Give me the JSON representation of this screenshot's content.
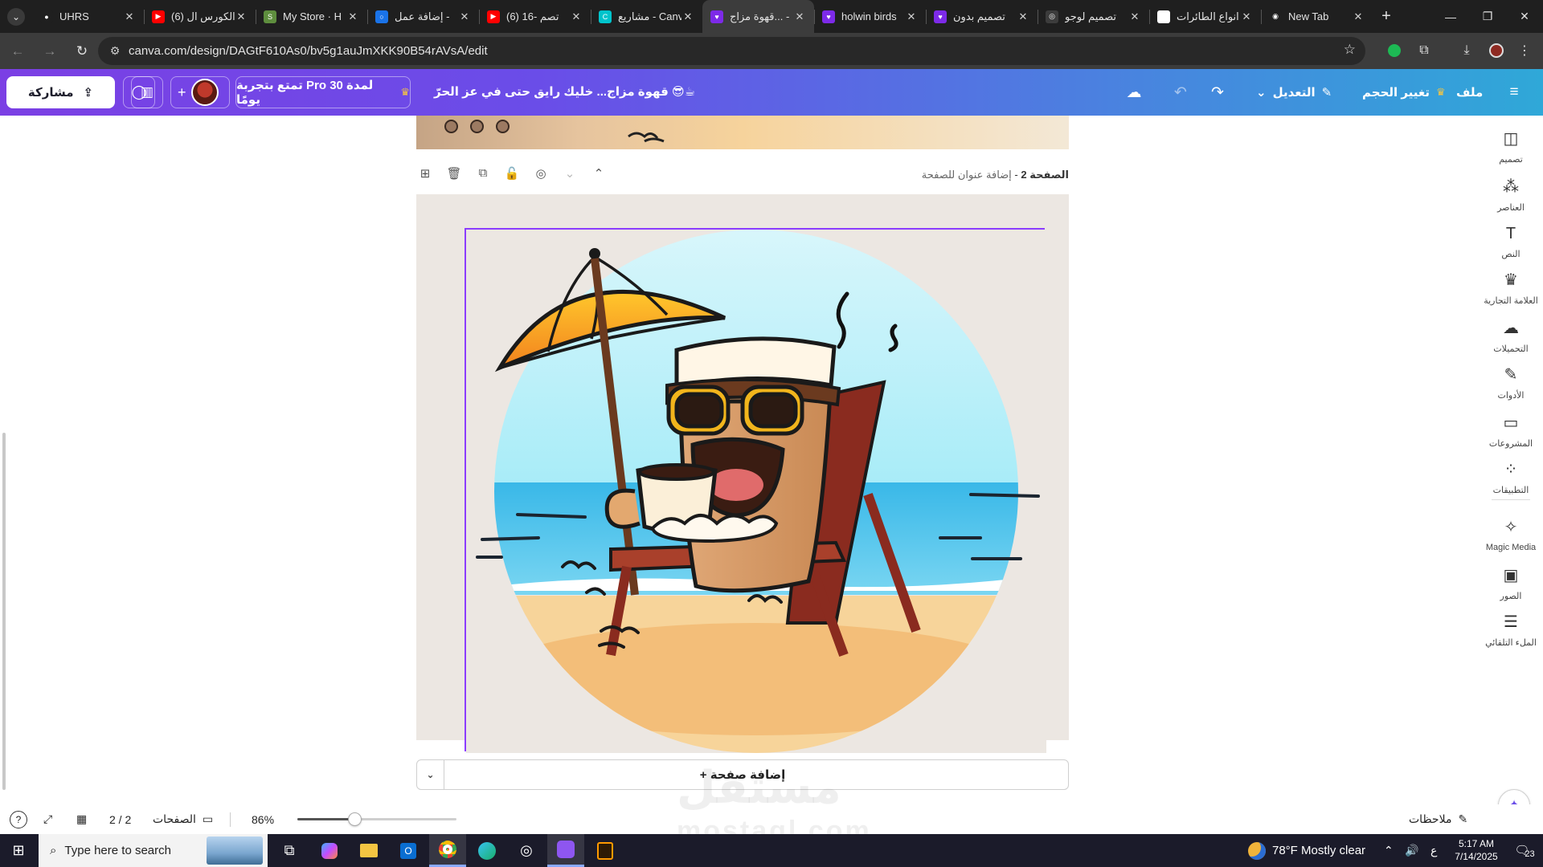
{
  "browser": {
    "tabs": [
      {
        "title": "UHRS",
        "favicon_color": "#1f1f1f",
        "favicon_glyph": "●"
      },
      {
        "title": "(6) الكورس ال",
        "favicon_color": "#ff0000",
        "favicon_glyph": "▶"
      },
      {
        "title": "My Store · H",
        "favicon_color": "#5e8e3e",
        "favicon_glyph": "S"
      },
      {
        "title": "إضافة عمل -",
        "favicon_color": "#1a73e8",
        "favicon_glyph": "○"
      },
      {
        "title": "(6) 16- تصم",
        "favicon_color": "#ff0000",
        "favicon_glyph": "▶"
      },
      {
        "title": "مشاريع - Canva",
        "favicon_color": "#00c4cc",
        "favicon_glyph": "C"
      },
      {
        "title": "قهوة مزاج... -",
        "favicon_color": "#7d2ae8",
        "favicon_glyph": "♥",
        "active": true
      },
      {
        "title": "holwin birds",
        "favicon_color": "#7d2ae8",
        "favicon_glyph": "♥"
      },
      {
        "title": "تصميم بدون",
        "favicon_color": "#7d2ae8",
        "favicon_glyph": "♥"
      },
      {
        "title": "تصميم لوجو",
        "favicon_color": "#3c3c3c",
        "favicon_glyph": "◎"
      },
      {
        "title": "انواع الطائرات",
        "favicon_color": "#ffffff",
        "favicon_glyph": "G"
      },
      {
        "title": "New Tab",
        "favicon_color": "#1f1f1f",
        "favicon_glyph": "◉"
      }
    ],
    "address": "canva.com/design/DAGtF610As0/bv5g1auJmXKK90B54rAVsA/edit",
    "new_tab_glyph": "+",
    "close_glyph": "✕"
  },
  "canva_header": {
    "menu_label": "ملف",
    "resize_label": "تغيير الحجم",
    "edit_label": "التعديل",
    "doc_title": "قهوة مزاج... خليك رايق حتى في عز الحرّ 😎☕",
    "pro_trial": "تمتع بتجربة Pro لمدة 30 يومًا",
    "share_label": "مشاركة"
  },
  "side_panel": {
    "items": [
      {
        "label": "تصميم",
        "icon": "design-icon"
      },
      {
        "label": "العناصر",
        "icon": "elements-icon"
      },
      {
        "label": "النص",
        "icon": "text-icon"
      },
      {
        "label": "العلامة التجارية",
        "icon": "brand-icon"
      },
      {
        "label": "التحميلات",
        "icon": "upload-icon"
      },
      {
        "label": "الأدوات",
        "icon": "tools-icon"
      },
      {
        "label": "المشروعات",
        "icon": "projects-icon"
      },
      {
        "label": "التطبيقات",
        "icon": "apps-icon"
      },
      {
        "label": "Magic Media",
        "icon": "magic-media-icon"
      },
      {
        "label": "الصور",
        "icon": "photos-icon"
      },
      {
        "label": "الملء التلقائي",
        "icon": "autofill-icon"
      }
    ]
  },
  "page": {
    "page_number_label": "الصفحة 2",
    "title_placeholder": "إضافة عنوان للصفحة",
    "add_page": "+ إضافة صفحة"
  },
  "status_bar": {
    "notes": "ملاحظات",
    "zoom": "86%",
    "zoom_fraction": 0.36,
    "pages_label": "الصفحات",
    "page_count": "2 / 2"
  },
  "taskbar": {
    "search_placeholder": "Type here to search",
    "weather": "78°F  Mostly clear",
    "time": "5:17 AM",
    "date": "7/14/2025",
    "notifications": "23",
    "lang": "ع"
  },
  "watermark": {
    "arabic": "مستقل",
    "latin": "mostaql.com"
  },
  "colors": {
    "canva_purple": "#7b3fe4",
    "canva_blue": "#2fa8d8",
    "selection": "#8b3dff"
  }
}
